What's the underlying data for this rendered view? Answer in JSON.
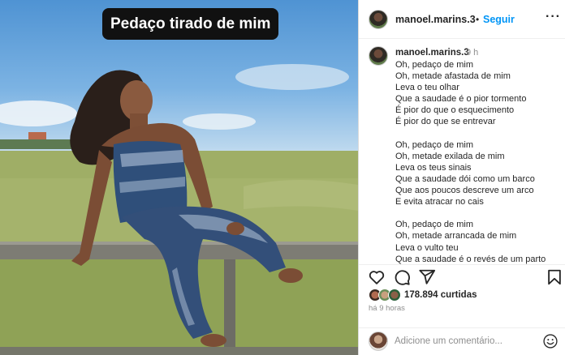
{
  "photo": {
    "caption_overlay": "Pedaço tirado de mim"
  },
  "header": {
    "username": "manoel.marins.3",
    "separator": "•",
    "follow_label": "Seguir",
    "more_label": "···"
  },
  "caption": {
    "username": "manoel.marins.3",
    "time": "9 h",
    "lines": [
      "Oh, pedaço de mim",
      "Oh, metade afastada de mim",
      "Leva o teu olhar",
      "Que a saudade é o pior tormento",
      "É pior do que o esquecimento",
      "É pior do que se entrevar",
      "",
      "Oh, pedaço de mim",
      "Oh, metade exilada de mim",
      "Leva os teus sinais",
      "Que a saudade dói como um barco",
      "Que aos poucos descreve um arco",
      "E evita atracar no cais",
      "",
      "Oh, pedaço de mim",
      "Oh, metade arrancada de mim",
      "Leva o vulto teu",
      "Que a saudade é o revés de um parto"
    ]
  },
  "actions": {
    "icons": [
      "heart-icon",
      "comment-icon",
      "share-icon",
      "bookmark-icon"
    ],
    "likes": "178.894 curtidas",
    "time_ago": "há 9 horas"
  },
  "comment": {
    "placeholder": "Adicione um comentário..."
  },
  "colors": {
    "accent": "#0095f6",
    "text": "#262626",
    "muted": "#8e8e8e"
  }
}
